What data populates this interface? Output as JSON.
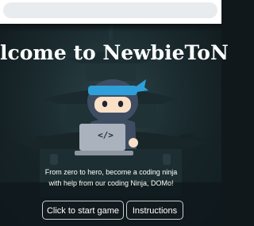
{
  "page": {
    "title": "lcome to NewbieToN",
    "description_line1": "From zero to hero, become a coding ninja",
    "description_line2": "with help from our coding Ninja, DOMo!",
    "laptop_code_glyph": "</>"
  },
  "buttons": {
    "start_label": "Click to start game",
    "instructions_label": "Instructions"
  },
  "colors": {
    "background": "#10181b",
    "headband": "#2e9fd8",
    "button_border": "#c9cfd2"
  },
  "icons": {
    "mascot": "ninja-mascot-icon",
    "laptop": "laptop-icon",
    "background_art": "pagoda-background-icon"
  }
}
